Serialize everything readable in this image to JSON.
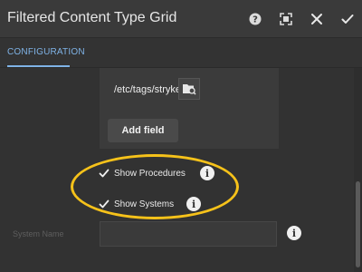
{
  "dialog": {
    "title": "Filtered Content Type Grid",
    "icons": [
      "help-icon",
      "fullscreen-icon",
      "close-icon",
      "checkmark-icon"
    ]
  },
  "tabs": [
    {
      "label": "CONFIGURATION",
      "active": true
    }
  ],
  "tag_field": {
    "value": "/etc/tags/stryker,",
    "browse_icon": "folder-browse-icon"
  },
  "add_field_label": "Add field",
  "checkboxes": [
    {
      "label": "Show Procedures",
      "checked": true,
      "info_icon": "info-icon"
    },
    {
      "label": "Show Systems",
      "checked": true,
      "info_icon": "info-icon"
    }
  ],
  "system_name": {
    "label": "System Name",
    "value": "",
    "info_icon": "info-icon"
  },
  "colors": {
    "accent": "#7fb3e6",
    "highlight": "#f6c21a",
    "background": "#323232"
  }
}
